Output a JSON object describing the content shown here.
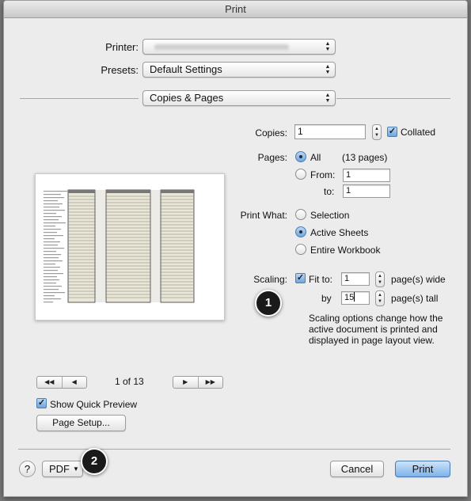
{
  "window": {
    "title": "Print"
  },
  "printer": {
    "label": "Printer:",
    "value": ""
  },
  "presets": {
    "label": "Presets:",
    "value": "Default Settings"
  },
  "section": {
    "value": "Copies & Pages"
  },
  "copies": {
    "label": "Copies:",
    "value": "1",
    "collated_label": "Collated",
    "collated": true
  },
  "pages": {
    "label": "Pages:",
    "all_label": "All",
    "all_count": "(13 pages)",
    "from_label": "From:",
    "from_value": "1",
    "to_label": "to:",
    "to_value": "1",
    "selected": "All"
  },
  "print_what": {
    "label": "Print What:",
    "options": [
      "Selection",
      "Active Sheets",
      "Entire Workbook"
    ],
    "selected": "Active Sheets"
  },
  "scaling": {
    "label": "Scaling:",
    "fit_to_label": "Fit to:",
    "fit_to_checked": true,
    "wide_value": "1",
    "wide_label": "page(s) wide",
    "by_label": "by",
    "tall_value": "15",
    "tall_label": "page(s) tall",
    "description": "Scaling options change how the active document is printed and displayed in page layout view."
  },
  "callouts": {
    "one": "1",
    "two": "2"
  },
  "pager": {
    "text": "1 of 13"
  },
  "quick_preview": {
    "label": "Show Quick Preview",
    "checked": true
  },
  "page_setup": {
    "label": "Page Setup..."
  },
  "footer": {
    "help": "?",
    "pdf": "PDF",
    "cancel": "Cancel",
    "print": "Print"
  },
  "colors": {
    "accent": "#6fa6dc",
    "callout": "#1a1a1a",
    "preview_column": "#e9e6d6"
  }
}
